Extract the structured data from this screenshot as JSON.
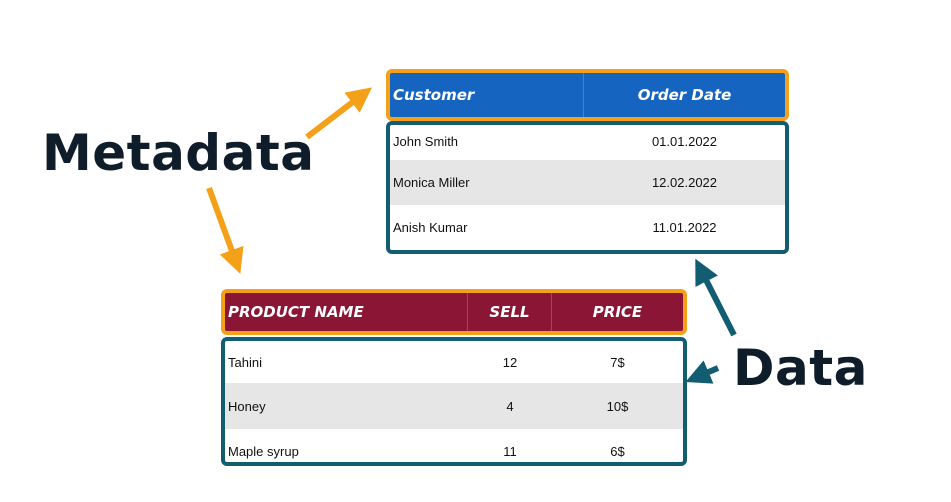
{
  "labels": {
    "metadata": "Metadata",
    "data": "Data"
  },
  "customer_table": {
    "headers": [
      "Customer",
      "Order Date"
    ],
    "rows": [
      [
        "John Smith",
        "01.01.2022"
      ],
      [
        "Monica Miller",
        "12.02.2022"
      ],
      [
        "Anish Kumar",
        "11.01.2022"
      ]
    ]
  },
  "product_table": {
    "headers": [
      "PRODUCT NAME",
      "SELL",
      "PRICE"
    ],
    "rows": [
      [
        "Tahini",
        "12",
        "7$"
      ],
      [
        "Honey",
        "4",
        "10$"
      ],
      [
        "Maple syrup",
        "11",
        "6$"
      ]
    ]
  },
  "colors": {
    "customer_header_bg": "#1565c0",
    "product_header_bg": "#8a1535",
    "metadata_accent": "#f4a018",
    "data_accent": "#135d72"
  }
}
